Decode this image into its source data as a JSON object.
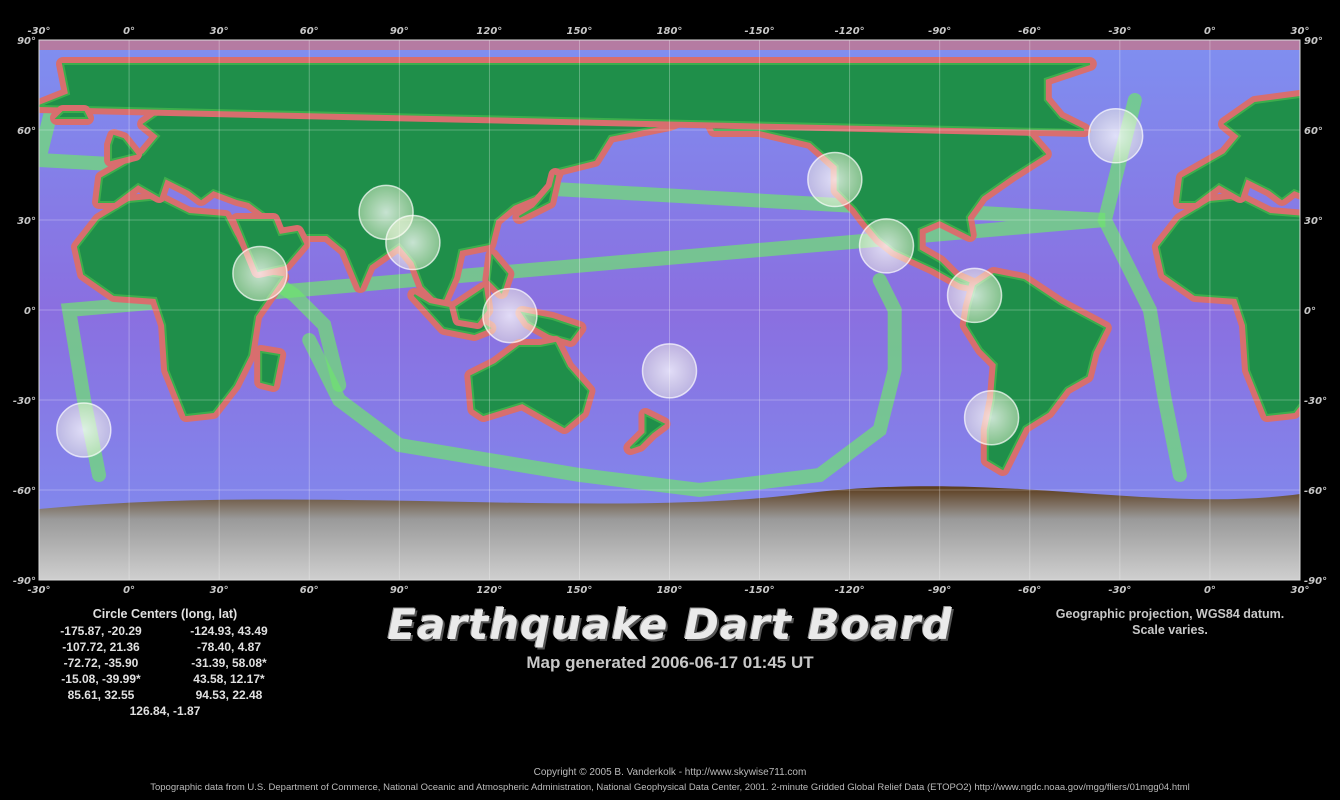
{
  "map": {
    "top_ticks": [
      "-30°",
      "0°",
      "30°",
      "60°",
      "90°",
      "120°",
      "150°",
      "180°",
      "-150°",
      "-120°",
      "-90°",
      "-60°",
      "-30°",
      "0°",
      "30°"
    ],
    "side_ticks": [
      "90°",
      "60°",
      "30°",
      "0°",
      "-30°",
      "-60°",
      "-90°"
    ],
    "circles": [
      {
        "lon": -175.87,
        "lat": -20.29,
        "lon_display": 180
      },
      {
        "lon": -124.93,
        "lat": 43.49
      },
      {
        "lon": -107.72,
        "lat": 21.36
      },
      {
        "lon": -78.4,
        "lat": 4.87
      },
      {
        "lon": -72.72,
        "lat": -35.9
      },
      {
        "lon": -31.39,
        "lat": 58.08
      },
      {
        "lon": -15.08,
        "lat": -39.99
      },
      {
        "lon": 43.58,
        "lat": 12.17
      },
      {
        "lon": 85.61,
        "lat": 32.55
      },
      {
        "lon": 94.53,
        "lat": 22.48
      },
      {
        "lon": 126.84,
        "lat": -1.87
      }
    ]
  },
  "centers": {
    "header": "Circle Centers (long, lat)",
    "rows": [
      [
        "-175.87,  -20.29",
        "-124.93,  43.49"
      ],
      [
        "-107.72,  21.36",
        "-78.40,   4.87"
      ],
      [
        "-72.72,  -35.90",
        "-31.39,  58.08*"
      ],
      [
        "-15.08,  -39.99*",
        "43.58,  12.17*"
      ],
      [
        "85.61,  32.55",
        "94.53,  22.48"
      ]
    ],
    "last": "126.84,   -1.87"
  },
  "title": "Earthquake Dart Board",
  "subtitle": "Map generated 2006-06-17 01:45 UT",
  "projection": [
    "Geographic projection, WGS84 datum.",
    "Scale varies."
  ],
  "copyright": "Copyright © 2005 B. Vanderkolk - http://www.skywise711.com",
  "source": "Topographic data from U.S. Department of Commerce, National Oceanic and Atmospheric Administration, National Geophysical Data Center, 2001. 2-minute Gridded Global Relief Data (ETOPO2) http://www.ngdc.noaa.gov/mgg/fliers/01mgg04.html",
  "colors": {
    "ocean_deep": "#8a6fe0",
    "ocean_mid": "#7f8ff0",
    "shelf": "#d86e6e",
    "ridge": "#6fe46f",
    "land_low": "#1f8f4a",
    "land_high": "#7a5a2a",
    "ice": "#9a9a9a"
  }
}
